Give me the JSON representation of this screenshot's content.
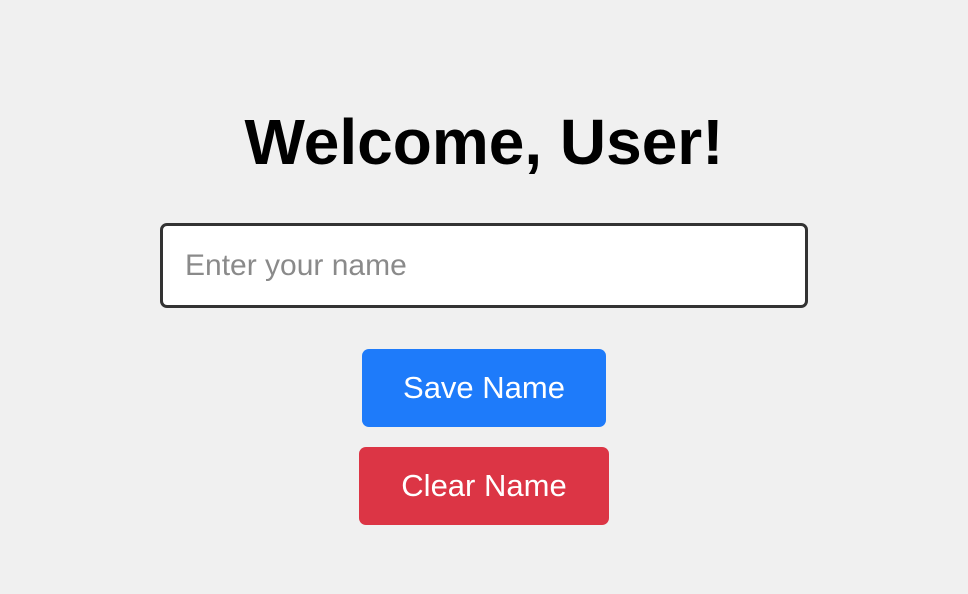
{
  "heading": {
    "text": "Welcome, User!"
  },
  "name_input": {
    "value": "",
    "placeholder": "Enter your name"
  },
  "buttons": {
    "save": {
      "label": "Save Name",
      "color": "#1e7bfa"
    },
    "clear": {
      "label": "Clear Name",
      "color": "#dc3545"
    }
  },
  "colors": {
    "background": "#f0f0f0",
    "input_border": "#333333"
  }
}
